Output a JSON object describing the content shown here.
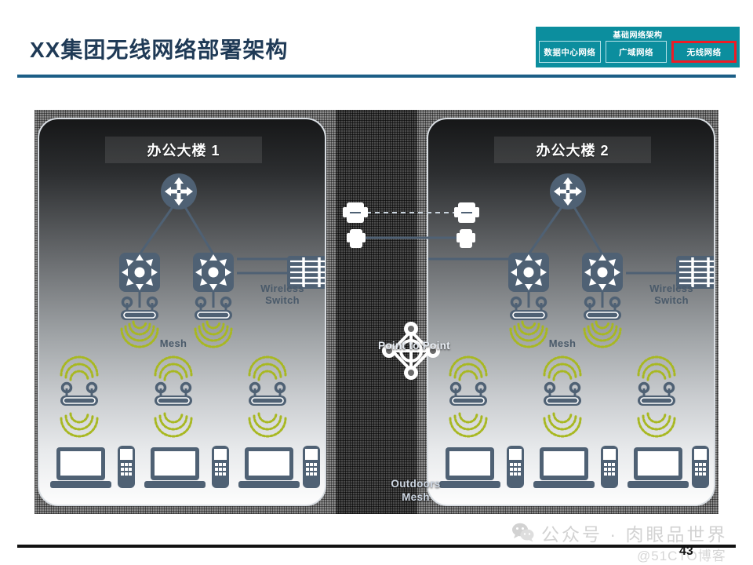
{
  "header": {
    "title": "XX集团无线网络部署架构"
  },
  "nav": {
    "heading": "基础网络架构",
    "tabs": [
      {
        "label": "数据中心网络",
        "active": false
      },
      {
        "label": "广域网络",
        "active": false
      },
      {
        "label": "无线网络",
        "active": true
      }
    ],
    "panel_color": "#0c8e9e",
    "active_outline_color": "#ee1c25"
  },
  "diagram": {
    "buildings": [
      {
        "title": "办公大楼 1",
        "wireless_switch_label": "Wireless Switch",
        "mesh_label": "Mesh",
        "router_count": 1,
        "switch_count": 2,
        "ceiling_ap_count": 2,
        "mesh_ap_count": 3,
        "laptop_count": 3,
        "phone_count": 3
      },
      {
        "title": "办公大楼 2",
        "wireless_switch_label": "Wireless Switch",
        "mesh_label": "Mesh",
        "router_count": 1,
        "switch_count": 2,
        "ceiling_ap_count": 2,
        "mesh_ap_count": 3,
        "laptop_count": 3,
        "phone_count": 3
      }
    ],
    "center": {
      "point_to_point_label": "Point to Point",
      "outdoors_mesh_label_line1": "Outdoors",
      "outdoors_mesh_label_line2": "Mesh"
    },
    "colors": {
      "device_icon": "#4a5a6a",
      "signal_arc": "#a8b821",
      "link_line": "#4f6174",
      "bridge_icon": "#ffffff"
    }
  },
  "footer": {
    "watermark": "公众号 · 肉眼品世界",
    "watermark_sub": "@51CTO博客",
    "page_number": "43"
  }
}
